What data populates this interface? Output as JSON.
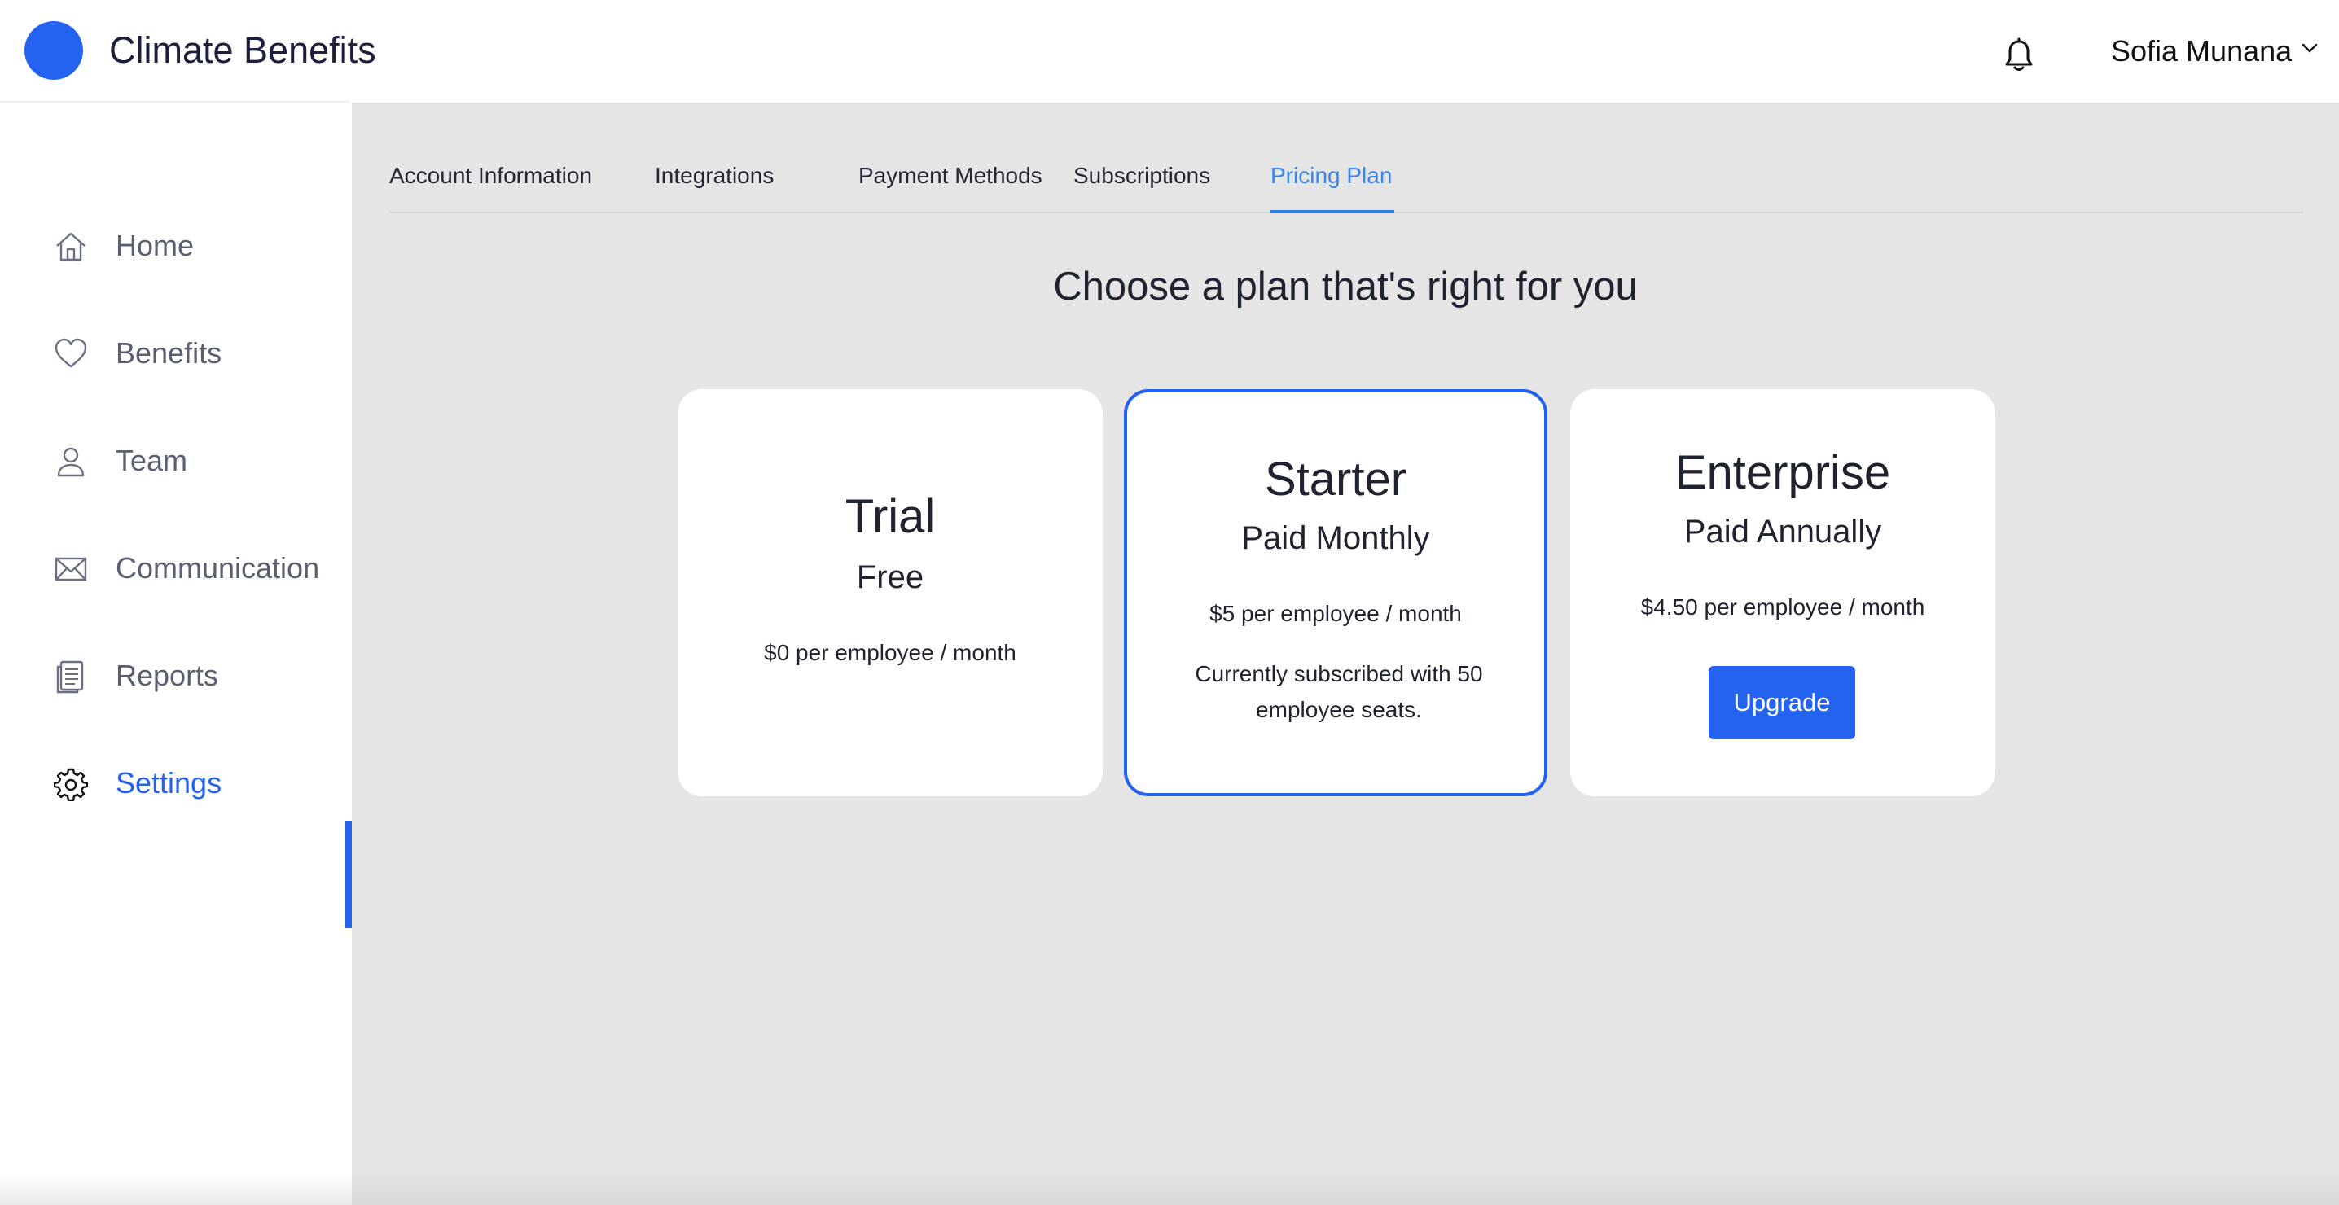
{
  "header": {
    "app_title": "Climate Benefits",
    "user_name": "Sofia Munana",
    "icons": {
      "logo": "circle-logo",
      "notifications": "bell-icon",
      "user_menu": "chevron-down-icon"
    }
  },
  "sidebar": {
    "items": [
      {
        "label": "Home",
        "icon": "home-icon",
        "active": false
      },
      {
        "label": "Benefits",
        "icon": "heart-icon",
        "active": false
      },
      {
        "label": "Team",
        "icon": "user-icon",
        "active": false
      },
      {
        "label": "Communication",
        "icon": "envelope-icon",
        "active": false
      },
      {
        "label": "Reports",
        "icon": "document-icon",
        "active": false
      },
      {
        "label": "Settings",
        "icon": "gear-icon",
        "active": true
      }
    ]
  },
  "main": {
    "tabs": [
      {
        "label": "Account Information",
        "active": false
      },
      {
        "label": "Integrations",
        "active": false
      },
      {
        "label": "Payment Methods",
        "active": false
      },
      {
        "label": "Subscriptions",
        "active": false
      },
      {
        "label": "Pricing Plan",
        "active": true
      }
    ],
    "heading": "Choose a plan that's right for you",
    "plans": [
      {
        "name": "Trial",
        "billing": "Free",
        "price": "$0 per employee / month",
        "current": false
      },
      {
        "name": "Starter",
        "billing": "Paid Monthly",
        "price": "$5 per employee / month",
        "note": "Currently subscribed with 50 employee seats.",
        "current": true
      },
      {
        "name": "Enterprise",
        "billing": "Paid Annually",
        "price": "$4.50 per employee / month",
        "action_label": "Upgrade",
        "current": false
      }
    ]
  },
  "colors": {
    "accent": "#2463f0",
    "active_tab": "#3a86e8",
    "main_background": "#e5e5e6",
    "nav_text": "#5a5f72"
  }
}
